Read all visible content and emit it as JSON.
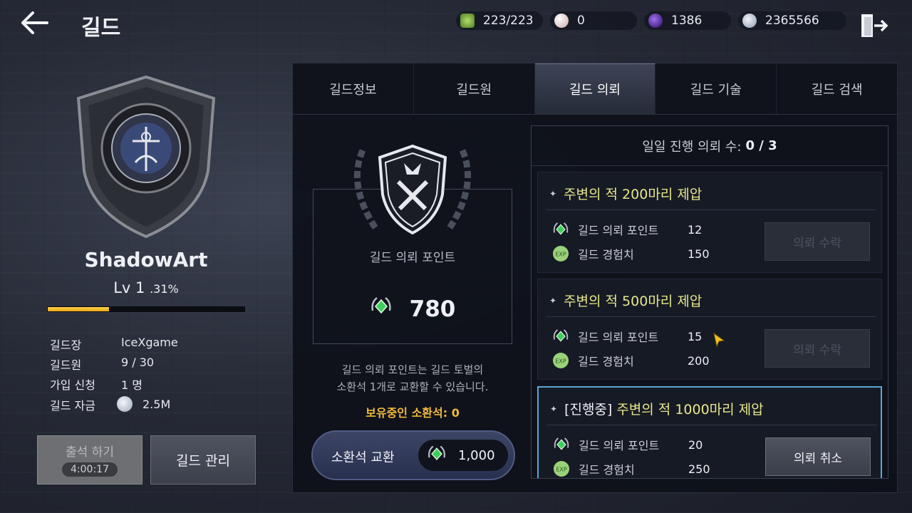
{
  "header": {
    "title": "길드",
    "currencies": [
      {
        "icon": "stamina-icon",
        "value": "223/223",
        "color": "#7fb24a"
      },
      {
        "icon": "pearl-icon",
        "value": "0",
        "color": "#d8c6c6"
      },
      {
        "icon": "purple-orb-icon",
        "value": "1386",
        "color": "#5a2aa8"
      },
      {
        "icon": "silver-coin-icon",
        "value": "2365566",
        "color": "#b9c4d6"
      }
    ]
  },
  "guild": {
    "name": "ShadowArt",
    "level": "Lv 1",
    "level_percent_label": ".31%",
    "xp_fill_fraction": 0.31,
    "info": [
      {
        "label": "길드장",
        "value": "IceXgame"
      },
      {
        "label": "길드원",
        "value": "9 / 30"
      },
      {
        "label": "가입 신청",
        "value": "1 명"
      },
      {
        "label": "길드 자금",
        "value": "2.5M"
      }
    ],
    "attend_label": "출석 하기",
    "attend_timer": "4:00:17",
    "manage_label": "길드 관리"
  },
  "tabs": [
    {
      "label": "길드정보",
      "active": false
    },
    {
      "label": "길드원",
      "active": false
    },
    {
      "label": "길드 의뢰",
      "active": true
    },
    {
      "label": "길드 기술",
      "active": false
    },
    {
      "label": "길드 검색",
      "active": false
    }
  ],
  "points": {
    "label": "길드 의뢰 포인트",
    "value": "780",
    "description_line1": "길드 의뢰 포인트는 길드 토벌의",
    "description_line2": "소환석 1개로 교환할 수 있습니다.",
    "owned": "보유중인 소환석: 0",
    "exchange_label": "소환석 교환",
    "exchange_cost": "1,000"
  },
  "quests": {
    "daily_label": "일일 진행 의뢰 수:",
    "daily_value": "0 / 3",
    "items": [
      {
        "prefix": "",
        "title": "주변의 적 200마리 제압",
        "point_label": "길드 의뢰 포인트",
        "point_value": "12",
        "exp_label": "길드 경험치",
        "exp_value": "150",
        "button": "의뢰 수락",
        "enabled": false
      },
      {
        "prefix": "",
        "title": "주변의 적 500마리 제압",
        "point_label": "길드 의뢰 포인트",
        "point_value": "15",
        "exp_label": "길드 경험치",
        "exp_value": "200",
        "button": "의뢰 수락",
        "enabled": false
      },
      {
        "prefix": "[진행중]",
        "title": "주변의 적 1000마리 제압",
        "point_label": "길드 의뢰 포인트",
        "point_value": "20",
        "exp_label": "길드 경험치",
        "exp_value": "250",
        "button": "의뢰 취소",
        "enabled": true
      }
    ]
  },
  "colors": {
    "accent_gold": "#f0b93a",
    "quest_title": "#e6e88a",
    "active_border": "#5aa6d8"
  }
}
